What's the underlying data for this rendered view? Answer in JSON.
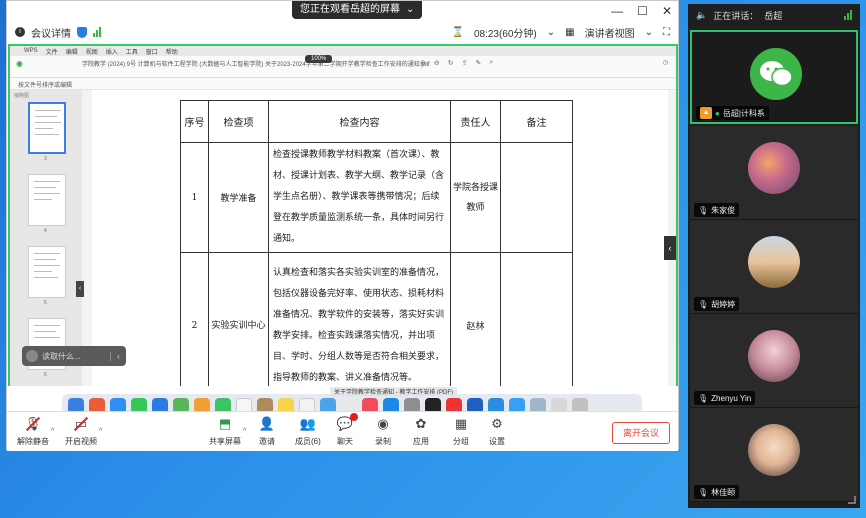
{
  "share_banner": {
    "text": "您正在观看岳超的屏幕",
    "menu_caret": "⌄"
  },
  "window_controls": {
    "minimize": "—",
    "maximize": "☐",
    "close": "✕"
  },
  "topbar": {
    "info_icon": "info-icon",
    "meeting_info": "会议详情",
    "timer": "08:23(60分钟)",
    "view_mode": "演讲者视图",
    "fullscreen_icon": "fullscreen-icon"
  },
  "shared_screen": {
    "menubar": [
      "WPS",
      "文件",
      "编辑",
      "视图",
      "插入",
      "工具",
      "窗口",
      "帮助"
    ],
    "doc_title": "学院教学 (2024) 9号 计算机与软件工程学院 (大数据与人工智能学院) 关于2023-2024学年第二学期开学教学检查工作安排的通知.pdf",
    "zoom_pill": "100%",
    "toolbar2_text": "按文件号排序或编辑",
    "thumb_label": "缩略图",
    "thumb_numbers": [
      "3",
      "4",
      "5",
      "6"
    ],
    "table": {
      "headers": [
        "序号",
        "检查项",
        "检查内容",
        "责任人",
        "备注"
      ],
      "rows": [
        {
          "no": "1",
          "item": "教学准备",
          "content": "检查授课教师教学材料教案（首次课）、教材、授课计划表、教学大纲、教学记录（含学生点名册）、教学课表等携带情况；后续登在教学质量监测系统一条，具体时间另行通知。",
          "owner": "学院各授课教师",
          "note": ""
        },
        {
          "no": "2",
          "item": "实验实训中心",
          "content": "认真检查和落实各实验实训室的准备情况，包括仪器设备完好率、使用状态、损耗材料准备情况、教学软件的安装等，落实好实训教学安排。检查实践课落实情况，并出项目、学时、分组人数等是否符合相关要求，指导教师的教案、讲义准备情况等。",
          "owner": "赵林",
          "note": ""
        }
      ]
    },
    "float_pill_text": "读取什么...",
    "dock_tooltip": "关于学院教学检查通知 - 教学工作安排 (PDF)"
  },
  "toolbar": {
    "unmute": "解除静音",
    "start_video": "开启视频",
    "share": "共享屏幕",
    "invite": "邀请",
    "participants": "成员(6)",
    "chat": "聊天",
    "record": "录制",
    "apps_room": "应用",
    "breakout": "分组",
    "settings": "设置",
    "end": "离开会议"
  },
  "gallery": {
    "header": "正在讲话：",
    "speaker": "岳超",
    "tiles": [
      {
        "name": "岳超|计科系",
        "role": "host"
      },
      {
        "name": "朱家俊"
      },
      {
        "name": "胡婷婷"
      },
      {
        "name": "Zhenyu Yin"
      },
      {
        "name": "林佳颐"
      }
    ]
  },
  "colors": {
    "accent_green": "#37c66a",
    "end_red": "#e24b3a",
    "wechat_green": "#3db649"
  }
}
